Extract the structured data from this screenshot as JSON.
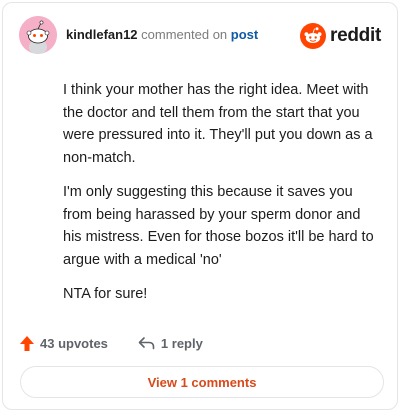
{
  "comment": {
    "username": "kindlefan12",
    "commented_on_text": "commented on",
    "post_link": "post",
    "paragraphs": [
      "I think your mother has the right idea. Meet with the doctor and tell them from the start that you were pressured into it. They'll put you down as a non-match.",
      "I'm only suggesting this because it saves you from being harassed by your sperm donor and his mistress. Even for those bozos it'll be hard to argue with a medical 'no'",
      "NTA for sure!"
    ]
  },
  "brand": {
    "name": "reddit",
    "accent": "#ff4500"
  },
  "actions": {
    "upvotes": "43 upvotes",
    "replies": "1 reply"
  },
  "view_button": "View 1 comments",
  "colors": {
    "avatar_bg": "#f5b0c8",
    "upvote_arrow": "#ff4500",
    "link": "#0f5aa6",
    "view_button_text": "#d84a1b"
  }
}
